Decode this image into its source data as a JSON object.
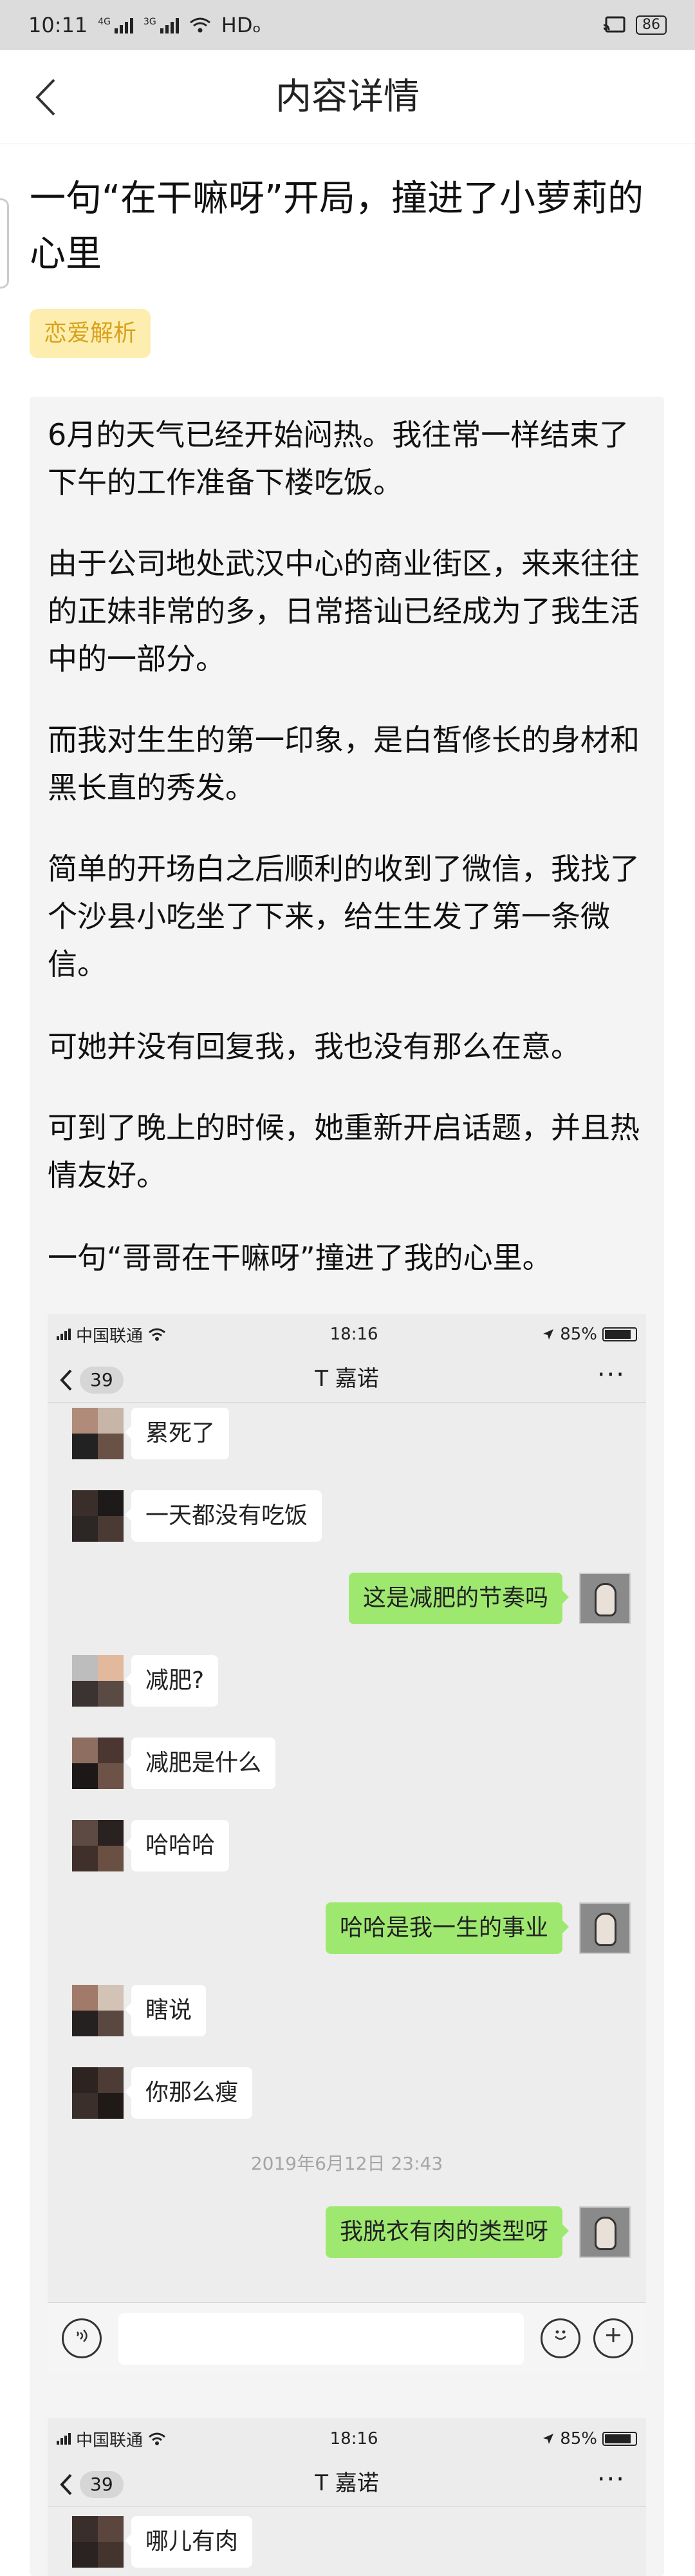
{
  "status_bar": {
    "time": "10:11",
    "network_1": "4G",
    "network_2": "3G",
    "hd": "HDₒ",
    "battery": "86"
  },
  "nav": {
    "title": "内容详情"
  },
  "article": {
    "title": "一句“在干嘛呀”开局，撞进了小萝莉的心里",
    "tag": "恋爱解析",
    "paragraphs": [
      "6月的天气已经开始闷热。我往常一样结束了下午的工作准备下楼吃饭。",
      "由于公司地处武汉中心的商业街区，来来往往的正妹非常的多，日常搭讪已经成为了我生活中的一部分。",
      "而我对生生的第一印象，是白皙修长的身材和黑长直的秀发。",
      "简单的开场白之后顺利的收到了微信，我找了个沙县小吃坐了下来，给生生发了第一条微信。",
      "可她并没有回复我，我也没有那么在意。",
      "可到了晚上的时候，她重新开启话题，并且热情友好。",
      " 一句“哥哥在干嘛呀”撞进了我的心里。"
    ]
  },
  "chat1": {
    "carrier": "中国联通",
    "time": "18:16",
    "battery": "85%",
    "unread": "39",
    "contact": "T 嘉诺",
    "more": "···",
    "messages": [
      {
        "side": "in",
        "text": "累死了"
      },
      {
        "side": "in",
        "text": "一天都没有吃饭"
      },
      {
        "side": "out",
        "text": "这是减肥的节奏吗"
      },
      {
        "side": "in",
        "text": "减肥?"
      },
      {
        "side": "in",
        "text": "减肥是什么"
      },
      {
        "side": "in",
        "text": "哈哈哈"
      },
      {
        "side": "out",
        "text": "哈哈是我一生的事业"
      },
      {
        "side": "in",
        "text": "瞎说"
      },
      {
        "side": "in",
        "text": "你那么瘦"
      }
    ],
    "timestamp": "2019年6月12日  23:43",
    "last_message": {
      "side": "out",
      "text": "我脱衣有肉的类型呀"
    },
    "input_placeholder": ""
  },
  "chat2": {
    "carrier": "中国联通",
    "time": "18:16",
    "battery": "85%",
    "unread": "39",
    "contact": "T 嘉诺",
    "more": "···",
    "first_message": {
      "side": "in",
      "text": "哪儿有肉"
    }
  },
  "colors": {
    "tag_bg": "#fdeeb0",
    "tag_text": "#d9a21c",
    "bubble_out": "#9fe870",
    "card_bg": "#f4f4f5"
  }
}
